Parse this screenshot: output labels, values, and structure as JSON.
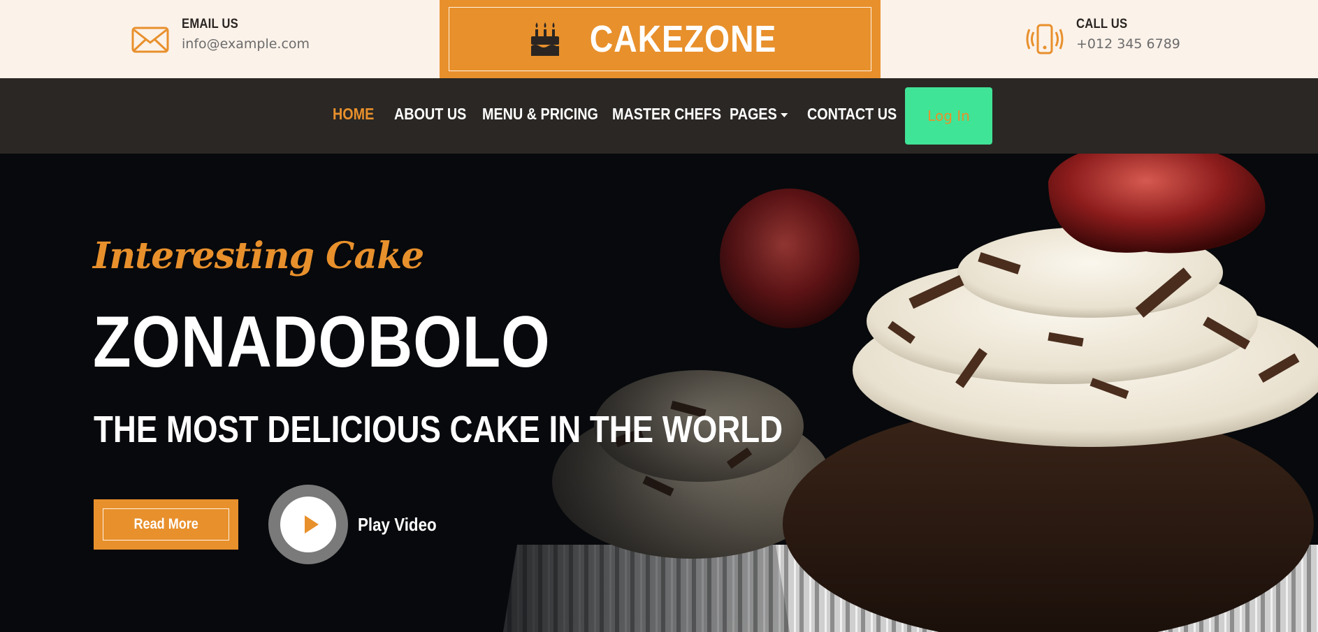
{
  "topbar": {
    "email": {
      "label": "EMAIL US",
      "value": "info@example.com",
      "icon": "envelope-icon"
    },
    "brand": {
      "name": "CAKEZONE",
      "icon": "birthday-cake-icon"
    },
    "phone": {
      "label": "CALL US",
      "value": "+012 345 6789",
      "icon": "phone-vibrate-icon"
    }
  },
  "nav": {
    "links": [
      {
        "label": "HOME",
        "active": true
      },
      {
        "label": "ABOUT US"
      },
      {
        "label": "MENU & PRICING"
      },
      {
        "label": "MASTER CHEFS"
      },
      {
        "label": "PAGES",
        "dropdown": true
      },
      {
        "label": "CONTACT US"
      }
    ],
    "login_label": "Log In"
  },
  "hero": {
    "script": "Interesting Cake",
    "title": "ZONADOBOLO",
    "subtitle": "THE MOST DELICIOUS CAKE IN THE WORLD",
    "read_more": "Read More",
    "play_video": "Play Video"
  },
  "colors": {
    "accent": "#e8902c",
    "topbar_bg": "#fbf2ea",
    "navbar_bg": "#2a2724",
    "login_bg": "#40e496",
    "hero_bg": "#07090c"
  }
}
